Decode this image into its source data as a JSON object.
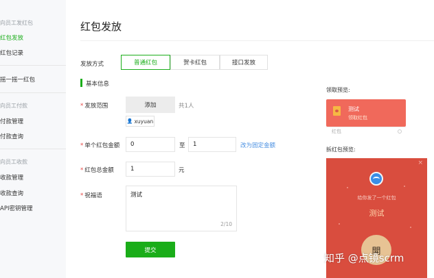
{
  "sidebar": {
    "items": [
      {
        "label": "向员工发红包",
        "kind": "group"
      },
      {
        "label": "红包发放",
        "kind": "item",
        "active": true
      },
      {
        "label": "红包记录",
        "kind": "item"
      },
      {
        "label": "摇一摇一红包",
        "kind": "item"
      },
      {
        "label": "向员工付款",
        "kind": "group"
      },
      {
        "label": "付款管理",
        "kind": "item"
      },
      {
        "label": "付款查询",
        "kind": "item"
      },
      {
        "label": "向员工收款",
        "kind": "group"
      },
      {
        "label": "收款管理",
        "kind": "item"
      },
      {
        "label": "收款查询",
        "kind": "item"
      },
      {
        "label": "API密钥管理",
        "kind": "item"
      }
    ]
  },
  "page": {
    "title": "红包发放"
  },
  "form": {
    "mode_label": "发放方式",
    "tabs": [
      "普通红包",
      "贺卡红包",
      "接口发放"
    ],
    "section_title": "基本信息",
    "scope": {
      "label": "发放范围",
      "add_button": "添加",
      "count": "共1人",
      "tag": "xuyuan"
    },
    "single_amount": {
      "label": "单个红包金额",
      "min": "0",
      "sep": "至",
      "max": "1",
      "link": "改为固定金额"
    },
    "total_amount": {
      "label": "红包总金额",
      "value": "1",
      "unit": "元"
    },
    "blessing": {
      "label": "祝福语",
      "value": "测试",
      "counter": "2/10"
    },
    "submit": "提交"
  },
  "preview": {
    "receive_label": "领取预览:",
    "card_title": "测试",
    "card_sub": "领取红包",
    "card_footer": "红包",
    "open_label": "拆红包预览:",
    "sender_msg": "给你发了一个红包",
    "blessing": "测试",
    "open_button": "開",
    "close": "×"
  },
  "watermark": "知乎 @点镜scrm",
  "colors": {
    "accent": "#1aad19",
    "red": "#d94d3e",
    "link": "#4a90e2"
  }
}
